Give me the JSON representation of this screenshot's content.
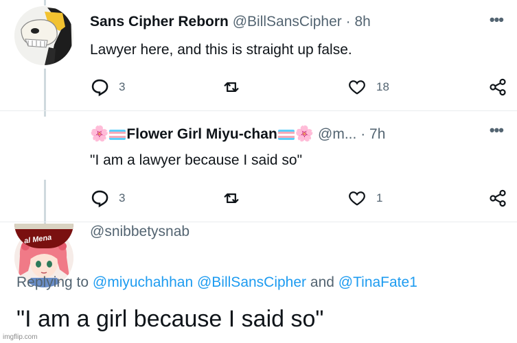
{
  "tweets": [
    {
      "display_name": "Sans Cipher Reborn",
      "handle": "@BillSansCipher",
      "separator": "·",
      "time": "8h",
      "text": "Lawyer here, and this is straight up false.",
      "reply_count": "3",
      "retweet_count": "",
      "like_count": "18"
    },
    {
      "display_name_prefix": "🌸",
      "display_name": "Flower Girl Miyu-chan",
      "display_name_suffix": "🌸",
      "handle": "@m...",
      "separator": "·",
      "time": "7h",
      "text": "\"I am a lawyer because I said so\"",
      "reply_count": "3",
      "retweet_count": "",
      "like_count": "1"
    }
  ],
  "partial_tweet": {
    "handle": "@snibbetysnab",
    "avatar_text": "al Mena"
  },
  "reply": {
    "prefix": "Replying to",
    "mention1": "@miyuchahhan",
    "mention2": "@BillSansCipher",
    "conjunction": "and",
    "mention3": "@TinaFate1",
    "text": "\"I am a girl because I said so\""
  },
  "watermark": "imgflip.com",
  "colors": {
    "accent": "#1d9bf0",
    "secondary_text": "#536471",
    "primary_text": "#0f1419"
  }
}
